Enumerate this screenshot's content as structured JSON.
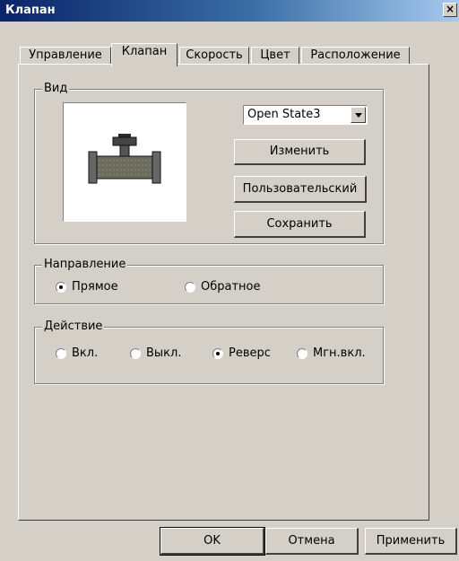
{
  "window": {
    "title": "Клапан",
    "close_glyph": "×"
  },
  "tabs": [
    {
      "label": "Управление",
      "active": false
    },
    {
      "label": "Клапан",
      "active": true
    },
    {
      "label": "Скорость",
      "active": false
    },
    {
      "label": "Цвет",
      "active": false
    },
    {
      "label": "Расположение",
      "active": false
    }
  ],
  "view_group": {
    "label": "Вид",
    "state_select": {
      "value": "Open State3"
    },
    "buttons": {
      "change": "Изменить",
      "custom": "Пользовательский",
      "save": "Сохранить"
    },
    "preview_icon": "valve-icon"
  },
  "direction_group": {
    "label": "Направление",
    "options": [
      {
        "label": "Прямое",
        "selected": true
      },
      {
        "label": "Обратное",
        "selected": false
      }
    ]
  },
  "action_group": {
    "label": "Действие",
    "options": [
      {
        "label": "Вкл.",
        "selected": false
      },
      {
        "label": "Выкл.",
        "selected": false
      },
      {
        "label": "Реверс",
        "selected": true
      },
      {
        "label": "Мгн.вкл.",
        "selected": false
      }
    ]
  },
  "footer": {
    "ok": "OK",
    "cancel": "Отмена",
    "apply": "Применить"
  },
  "colors": {
    "titlebar_start": "#0a246a",
    "face": "#d4d0c8",
    "valve_body": "#6b6b5e"
  }
}
